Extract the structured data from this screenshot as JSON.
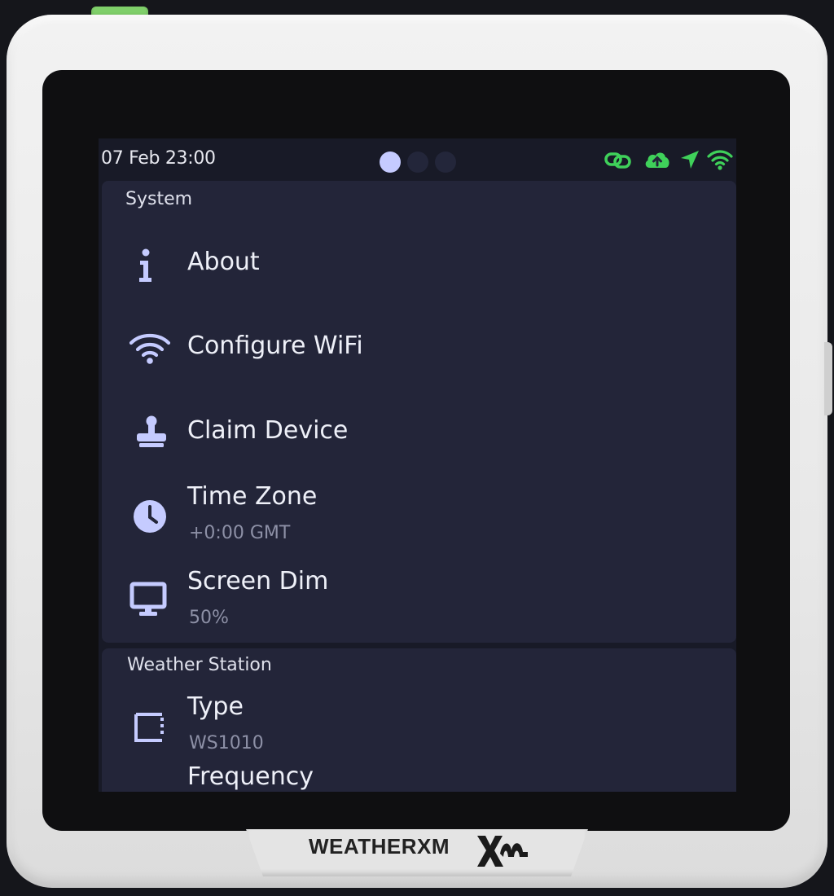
{
  "status_bar": {
    "datetime": "07 Feb 23:00",
    "pages": [
      {
        "active": true
      },
      {
        "active": false
      },
      {
        "active": false
      }
    ],
    "icons": [
      "link-icon",
      "cloud-upload-icon",
      "location-arrow-icon",
      "wifi-icon"
    ],
    "icon_color": "#3fd15a"
  },
  "system": {
    "title": "System",
    "items": [
      {
        "icon": "info-icon",
        "label": "About"
      },
      {
        "icon": "wifi-icon",
        "label": "Configure WiFi"
      },
      {
        "icon": "stamp-icon",
        "label": "Claim Device"
      },
      {
        "icon": "clock-icon",
        "label": "Time Zone",
        "value": "+0:00 GMT"
      },
      {
        "icon": "monitor-icon",
        "label": "Screen Dim",
        "value": "50%"
      }
    ]
  },
  "weather_station": {
    "title": "Weather Station",
    "items": [
      {
        "icon": "square-dashed-icon",
        "label": "Type",
        "value": "WS1010"
      },
      {
        "icon": "frequency-icon",
        "label": "Frequency"
      }
    ]
  },
  "brand": {
    "name": "WEATHERXM",
    "mark": "XM"
  },
  "colors": {
    "screen_bg": "#181a27",
    "card_bg": "#232539",
    "icon": "#c5cbff",
    "active_dot": "#c5cbff",
    "status_green": "#3fd15a"
  }
}
